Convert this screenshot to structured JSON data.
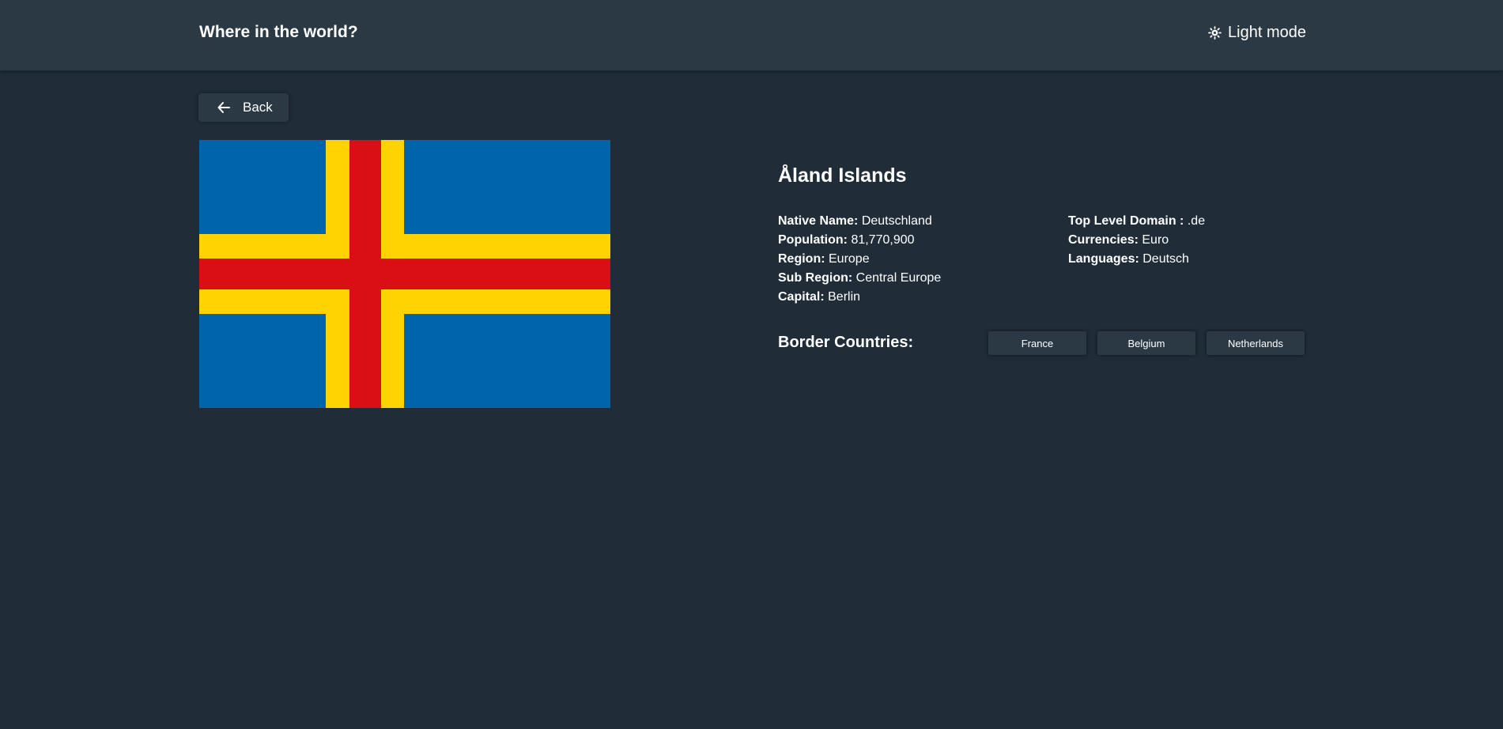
{
  "header": {
    "title": "Where in the world?",
    "mode_toggle": {
      "icon": "sun-icon",
      "label": "Light mode"
    }
  },
  "back_button": {
    "icon": "arrow-left-icon",
    "label": "Back"
  },
  "country": {
    "name": "Åland Islands",
    "flag": {
      "colors": {
        "field": "#0064ad",
        "outer_cross": "#ffd300",
        "inner_cross": "#da0e15"
      }
    },
    "details_left": [
      {
        "label": "Native Name:",
        "value": "Deutschland"
      },
      {
        "label": "Population:",
        "value": "81,770,900"
      },
      {
        "label": "Region:",
        "value": "Europe"
      },
      {
        "label": "Sub Region:",
        "value": "Central Europe"
      },
      {
        "label": "Capital:",
        "value": "Berlin"
      }
    ],
    "details_right": [
      {
        "label": "Top Level Domain :",
        "value": ".de"
      },
      {
        "label": "Currencies:",
        "value": "Euro"
      },
      {
        "label": "Languages:",
        "value": "Deutsch"
      }
    ],
    "border_countries_label": "Border Countries:",
    "border_countries": [
      "France",
      "Belgium",
      "Netherlands"
    ]
  },
  "theme": {
    "background": "#202c37",
    "surface": "#2b3945",
    "text": "#ffffff"
  }
}
